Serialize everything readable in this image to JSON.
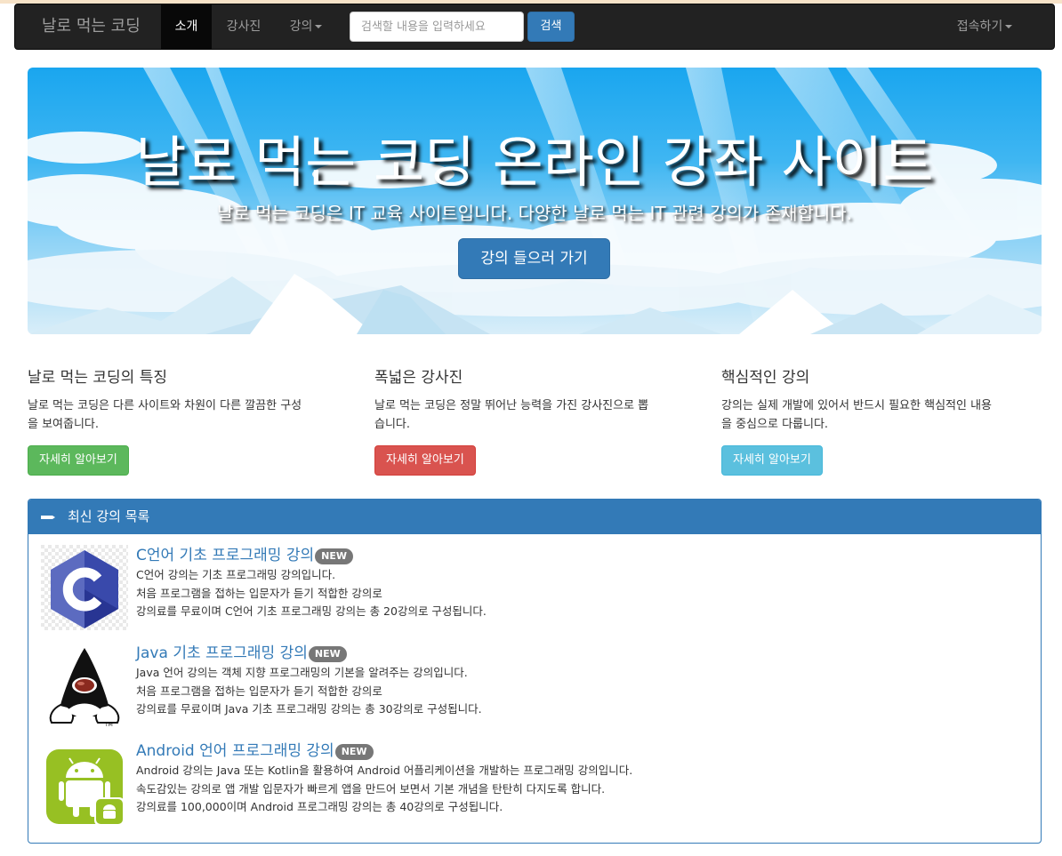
{
  "navbar": {
    "brand": "날로 먹는 코딩",
    "items": [
      {
        "label": "소개",
        "active": true
      },
      {
        "label": "강사진",
        "active": false
      },
      {
        "label": "강의",
        "active": false
      }
    ],
    "search_placeholder": "검색할 내용을 입력하세요",
    "search_button": "검색",
    "right_menu": "접속하기"
  },
  "jumbotron": {
    "title": "날로 먹는 코딩 온라인 강좌 사이트",
    "subtitle": "날로 먹는 코딩은 IT 교육 사이트입니다. 다양한 날로 먹는 IT 관련 강의가 존재합니다.",
    "button": "강의 들으러 가기"
  },
  "features": [
    {
      "title": "날로 먹는 코딩의 특징",
      "line1": "날로 먹는 코딩은 다른 사이트와 차원이 다른 깔끔한 구성",
      "line2": "을 보여줍니다.",
      "button": "자세히 알아보기"
    },
    {
      "title": "폭넓은 강사진",
      "line1": "날로 먹는 코딩은 정말 뛰어난 능력을 가진 강사진으로 뽑",
      "line2": "습니다.",
      "button": "자세히 알아보기"
    },
    {
      "title": "핵심적인 강의",
      "line1": "강의는 실제 개발에 있어서 반드시 필요한 핵심적인 내용",
      "line2": "을 중심으로 다룹니다.",
      "button": "자세히 알아보기"
    }
  ],
  "colors": {
    "primary": "#337ab7",
    "success": "#5cb85c",
    "danger": "#d9534f",
    "info": "#5bc0de",
    "navbar": "#222222"
  },
  "panel": {
    "heading": "최신 강의 목록",
    "icon": "pencil-icon",
    "courses": [
      {
        "title": "C언어 기초 프로그래밍 강의",
        "badge": "NEW",
        "icon": "c-language-logo",
        "lines": [
          "C언어 강의는 기초 프로그래밍 강의입니다.",
          "처음 프로그램을 접하는 입문자가 듣기 적합한 강의로",
          "강의료를 무료이며 C언어 기초 프로그래밍 강의는 총 20강의로 구성됩니다."
        ]
      },
      {
        "title": "Java 기초 프로그래밍 강의",
        "badge": "NEW",
        "icon": "java-duke-logo",
        "lines": [
          "Java 언어 강의는 객체 지향 프로그래밍의 기본을 알려주는 강의입니다.",
          "처음 프로그램을 접하는 입문자가 듣기 적합한 강의로",
          "강의료를 무료이며 Java 기초 프로그래밍 강의는 총 30강의로 구성됩니다."
        ]
      },
      {
        "title": "Android 언어 프로그래밍 강의",
        "badge": "NEW",
        "icon": "android-logo",
        "lines": [
          "Android 강의는 Java 또는 Kotlin을 활용하여 Android 어플리케이션을 개발하는 프로그래밍 강의입니다.",
          "속도감있는 강의로 앱 개발 입문자가 빠르게 앱을 만드어 보면서 기본 개념을 탄탄히 다지도록 합니다.",
          "강의료를 100,000이며 Android 프로그래밍 강의는 총 40강의로 구성됩니다."
        ]
      }
    ]
  }
}
